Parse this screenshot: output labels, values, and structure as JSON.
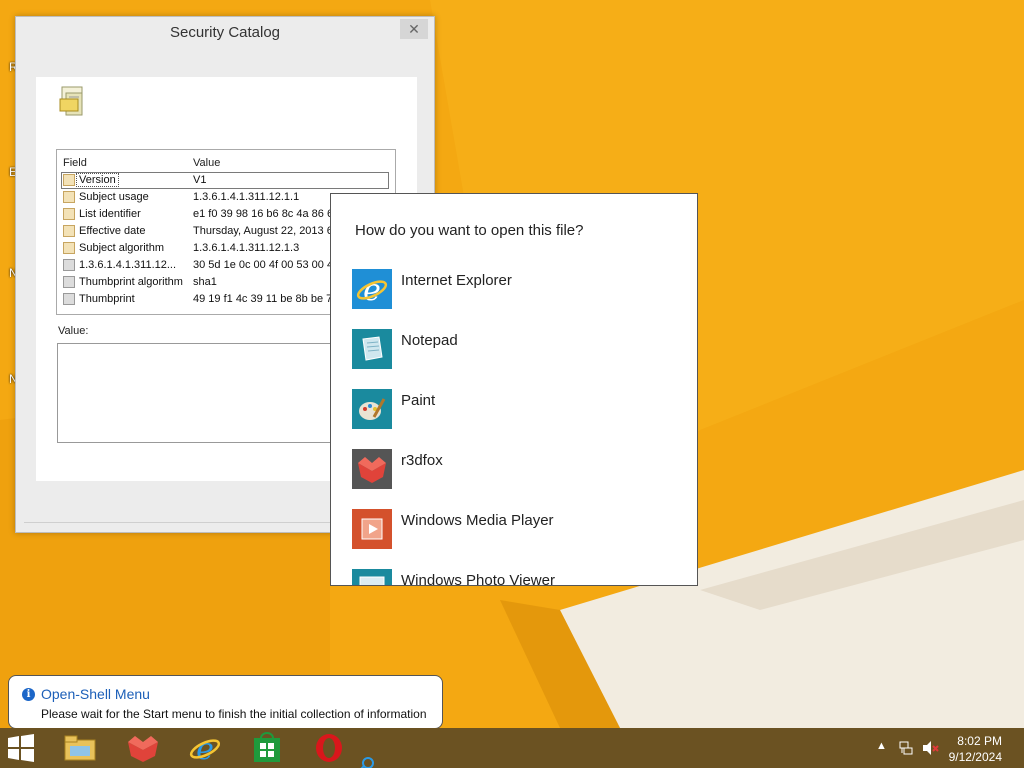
{
  "desktop": {
    "side_fragments": [
      "R",
      "E",
      "N",
      "N"
    ]
  },
  "security_catalog": {
    "title": "Security Catalog",
    "close_label": "✕",
    "columns": {
      "field": "Field",
      "value": "Value"
    },
    "rows": [
      {
        "field": "Version",
        "value": "V1"
      },
      {
        "field": "Subject usage",
        "value": "1.3.6.1.4.1.311.12.1.1"
      },
      {
        "field": "List identifier",
        "value": "e1 f0 39 98 16 b6 8c 4a 86 6"
      },
      {
        "field": "Effective date",
        "value": "Thursday, August 22, 2013 6"
      },
      {
        "field": "Subject algorithm",
        "value": "1.3.6.1.4.1.311.12.1.3"
      },
      {
        "field": "1.3.6.1.4.1.311.12...",
        "value": "30 5d 1e 0c 00 4f 00 53 00 4"
      },
      {
        "field": "Thumbprint algorithm",
        "value": "sha1"
      },
      {
        "field": "Thumbprint",
        "value": "49 19 f1 4c 39 11 be 8b be 7"
      }
    ],
    "value_label": "Value:"
  },
  "open_with": {
    "question": "How do you want to open this file?",
    "apps": [
      {
        "name": "Internet Explorer",
        "icon": "internet-explorer-icon",
        "color": "#1f8fd6"
      },
      {
        "name": "Notepad",
        "icon": "notepad-icon",
        "color": "#1a8a9e"
      },
      {
        "name": "Paint",
        "icon": "paint-icon",
        "color": "#1a8a9e"
      },
      {
        "name": "r3dfox",
        "icon": "r3dfox-icon",
        "color": "#555555"
      },
      {
        "name": "Windows Media Player",
        "icon": "media-player-icon",
        "color": "#d4512c"
      },
      {
        "name": "Windows Photo Viewer",
        "icon": "photo-viewer-icon",
        "color": "#1a8a9e"
      }
    ]
  },
  "notification": {
    "title": "Open-Shell Menu",
    "message": "Please wait for the Start menu to finish the initial collection of information"
  },
  "taskbar": {
    "pinned": [
      "start-button",
      "file-explorer-icon",
      "r3dfox-icon",
      "internet-explorer-icon",
      "store-icon",
      "opera-icon"
    ],
    "time": "8:02 PM",
    "date": "9/12/2024"
  },
  "colors": {
    "wallpaper": "#f4a812",
    "taskbar": "#6b5222",
    "accent_blue": "#1c66c8"
  }
}
